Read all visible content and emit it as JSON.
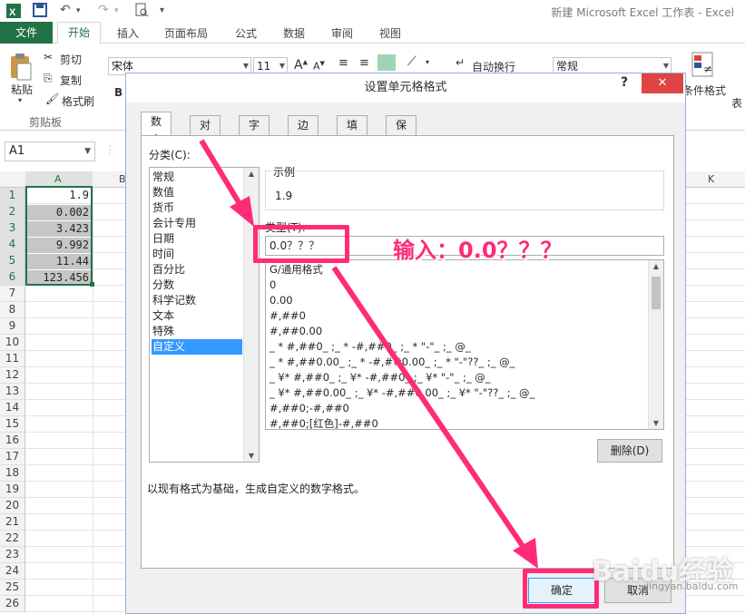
{
  "app": {
    "title": "新建 Microsoft Excel 工作表 - Excel"
  },
  "ribbon_tabs": [
    "文件",
    "开始",
    "插入",
    "页面布局",
    "公式",
    "数据",
    "审阅",
    "视图"
  ],
  "clipboard": {
    "paste": "粘贴",
    "cut": "剪切",
    "copy": "复制",
    "format_painter": "格式刷",
    "group": "剪贴板"
  },
  "font": {
    "name": "宋体",
    "size": "11",
    "bold": "B"
  },
  "alignment": {
    "wrap_text": "自动换行"
  },
  "number": {
    "format": "常规"
  },
  "styles": {
    "conditional_format": "条件格式",
    "table": "表"
  },
  "name_box": "A1",
  "columns": [
    "A",
    "B",
    "K"
  ],
  "rows": [
    "1",
    "2",
    "3",
    "4",
    "5",
    "6",
    "7",
    "8",
    "9",
    "10",
    "11",
    "12",
    "13",
    "14",
    "15",
    "16",
    "17",
    "18",
    "19",
    "20",
    "21",
    "22",
    "23",
    "24",
    "25",
    "26"
  ],
  "cells": [
    "1.9",
    "0.002",
    "3.423",
    "9.992",
    "11.44",
    "123.456"
  ],
  "dialog": {
    "title": "设置单元格格式",
    "help": "?",
    "close": "✕",
    "tabs": [
      "数字",
      "对齐",
      "字体",
      "边框",
      "填充",
      "保护"
    ],
    "category_label": "分类(C):",
    "categories": [
      "常规",
      "数值",
      "货币",
      "会计专用",
      "日期",
      "时间",
      "百分比",
      "分数",
      "科学记数",
      "文本",
      "特殊",
      "自定义"
    ],
    "selected_category": "自定义",
    "sample_label": "示例",
    "sample_value": "1.9",
    "type_label": "类型(T):",
    "type_value": "0.0？？？",
    "formats": [
      "G/通用格式",
      "0",
      "0.00",
      "#,##0",
      "#,##0.00",
      "_ * #,##0_ ;_ * -#,##0_ ;_ * \"-\"_ ;_ @_",
      "_ * #,##0.00_ ;_ * -#,##0.00_ ;_ * \"-\"??_ ;_ @_",
      "_ ¥* #,##0_ ;_ ¥* -#,##0_ ;_ ¥* \"-\"_ ;_ @_",
      "_ ¥* #,##0.00_ ;_ ¥* -#,##0.00_ ;_ ¥* \"-\"??_ ;_ @_",
      "#,##0;-#,##0",
      "#,##0;[红色]-#,##0"
    ],
    "delete_button": "删除(D)",
    "description": "以现有格式为基础，生成自定义的数字格式。",
    "ok_button": "确定",
    "cancel_button": "取消"
  },
  "annotation": {
    "text": "输入：0.0？？？",
    "color": "#ff2b78"
  },
  "watermark": {
    "text": "Baidu经验",
    "sub": "jingyan.baidu.com"
  },
  "colors": {
    "excel_green": "#217346",
    "selection_blue": "#3399ff",
    "close_red": "#e04343"
  }
}
